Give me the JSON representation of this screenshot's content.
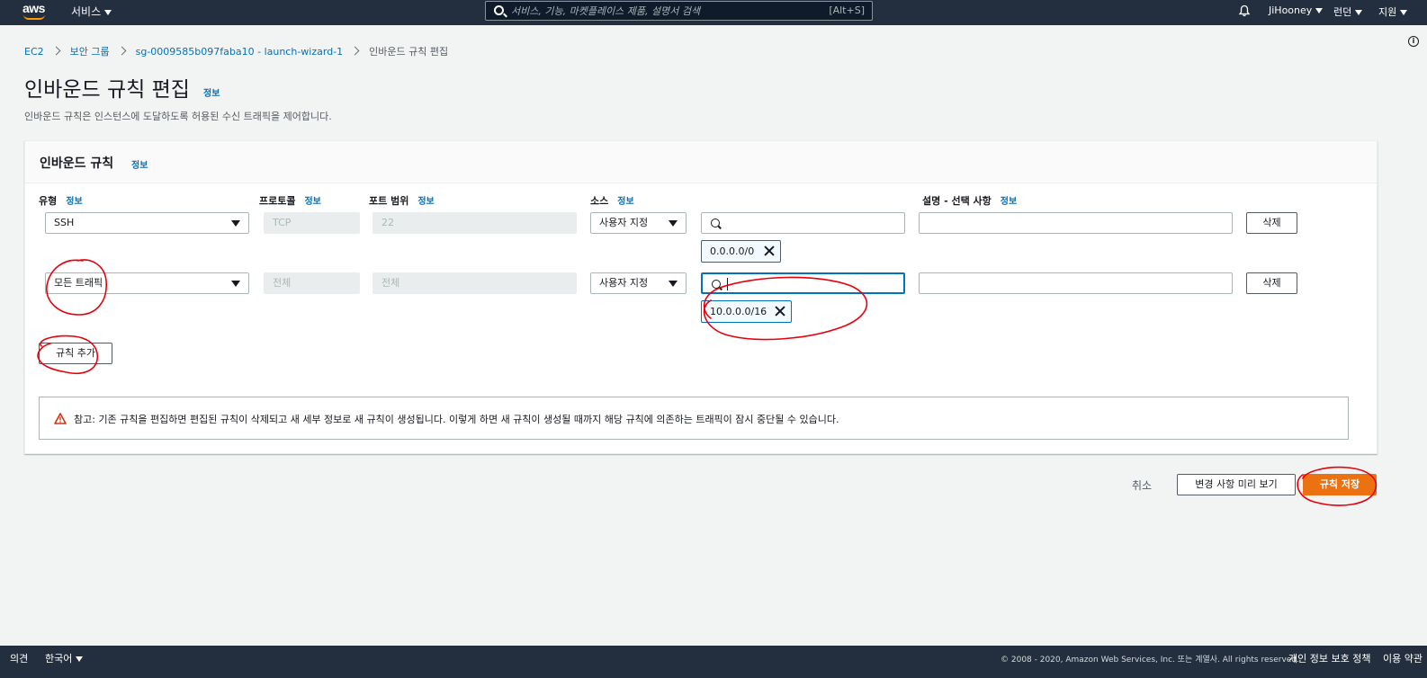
{
  "topnav": {
    "logo_text": "aws",
    "services_label": "서비스",
    "search_placeholder": "서비스, 기능, 마켓플레이스 제품, 설명서 검색",
    "search_shortcut": "[Alt+S]",
    "user": "JiHooney",
    "region": "런던",
    "support": "지원"
  },
  "breadcrumb": {
    "items": [
      "EC2",
      "보안 그룹",
      "sg-0009585b097faba10 - launch-wizard-1"
    ],
    "current": "인바운드 규칙 편집"
  },
  "page": {
    "title": "인바운드 규칙 편집",
    "info": "정보",
    "description": "인바운드 규칙은 인스턴스에 도달하도록 허용된 수신 트래픽을 제어합니다."
  },
  "panel": {
    "title": "인바운드 규칙",
    "info": "정보",
    "columns": {
      "type": "유형",
      "protocol": "프로토콜",
      "port_range": "포트 범위",
      "source": "소스",
      "description": "설명 - 선택 사항",
      "info": "정보"
    },
    "rules": [
      {
        "type": "SSH",
        "protocol": "TCP",
        "port_range": "22",
        "source_type": "사용자 지정",
        "source_search": "",
        "source_token": "0.0.0.0/0",
        "description": "",
        "delete_label": "삭제"
      },
      {
        "type": "모든 트래픽",
        "protocol": "전체",
        "port_range": "전체",
        "source_type": "사용자 지정",
        "source_search": "",
        "source_token": "10.0.0.0/16",
        "description": "",
        "delete_label": "삭제"
      }
    ],
    "add_rule_label": "규칙 추가",
    "warning": "참고: 기존 규칙을 편집하면 편집된 규칙이 삭제되고 새 세부 정보로 새 규칙이 생성됩니다. 이렇게 하면 새 규칙이 생성될 때까지 해당 규칙에 의존하는 트래픽이 잠시 중단될 수 있습니다."
  },
  "actions": {
    "cancel": "취소",
    "preview": "변경 사항 미리 보기",
    "save": "규칙 저장"
  },
  "footer": {
    "feedback": "의견",
    "language": "한국어",
    "copyright": "© 2008 - 2020, Amazon Web Services, Inc. 또는 계열사. All rights reserved.",
    "privacy": "개인 정보 보호 정책",
    "terms": "이용 약관"
  },
  "colors": {
    "nav_bg": "#232f3e",
    "link": "#0073bb",
    "primary": "#ec7211",
    "annotation": "#e8000b"
  }
}
